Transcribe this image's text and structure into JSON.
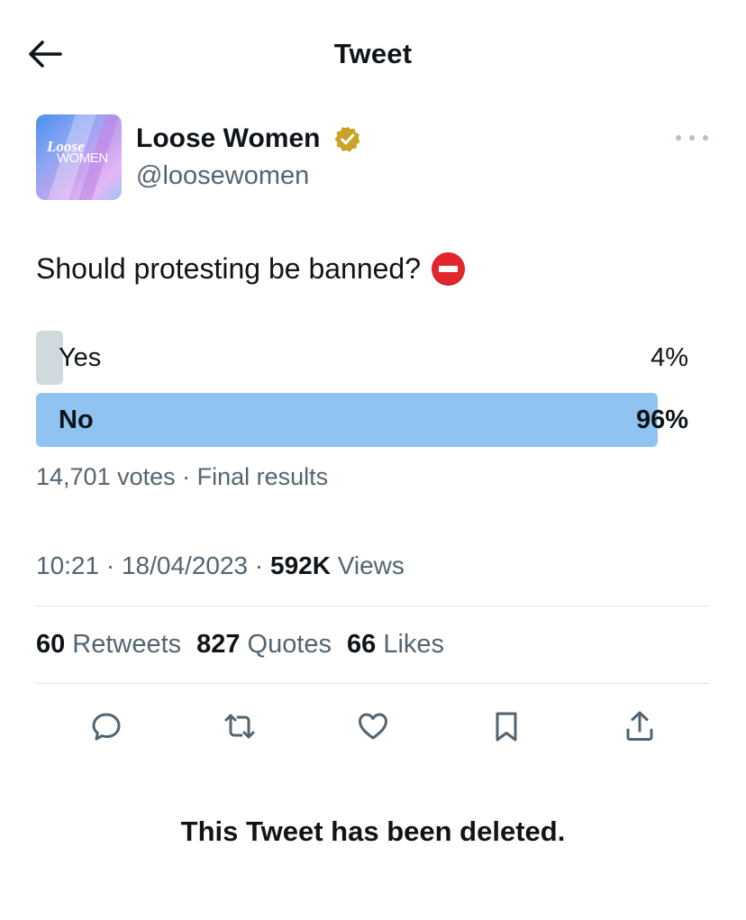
{
  "header": {
    "title": "Tweet",
    "back_icon": "arrow-left-icon"
  },
  "author": {
    "display_name": "Loose Women",
    "handle": "@loosewomen",
    "verified_badge_color": "#c9a227",
    "avatar_logo": [
      "Loose",
      "WOMEN"
    ],
    "more_icon": "more-horizontal-icon"
  },
  "tweet": {
    "text": "Should protesting be banned?",
    "emoji": "no-entry-icon"
  },
  "poll": {
    "options": [
      {
        "label": "Yes",
        "percent_text": "4%",
        "value": 4,
        "bar_color": "#cfd9de",
        "winner": false
      },
      {
        "label": "No",
        "percent_text": "96%",
        "value": 96,
        "bar_color": "#8ec3f2",
        "winner": true
      }
    ],
    "meta": "14,701 votes · Final results"
  },
  "timestamp": {
    "time": "10:21",
    "separator": " · ",
    "date": "18/04/2023",
    "views_count": "592K",
    "views_label": "Views"
  },
  "stats": {
    "retweets": {
      "count": "60",
      "label": "Retweets"
    },
    "quotes": {
      "count": "827",
      "label": "Quotes"
    },
    "likes": {
      "count": "66",
      "label": "Likes"
    }
  },
  "actions": [
    "reply-icon",
    "retweet-icon",
    "like-icon",
    "bookmark-icon",
    "share-icon"
  ],
  "deleted_note": "This Tweet has been deleted.",
  "colors": {
    "text": "#0f1419",
    "secondary": "#536471",
    "divider": "#dfe3e7",
    "accent": "#1d9bf0"
  }
}
